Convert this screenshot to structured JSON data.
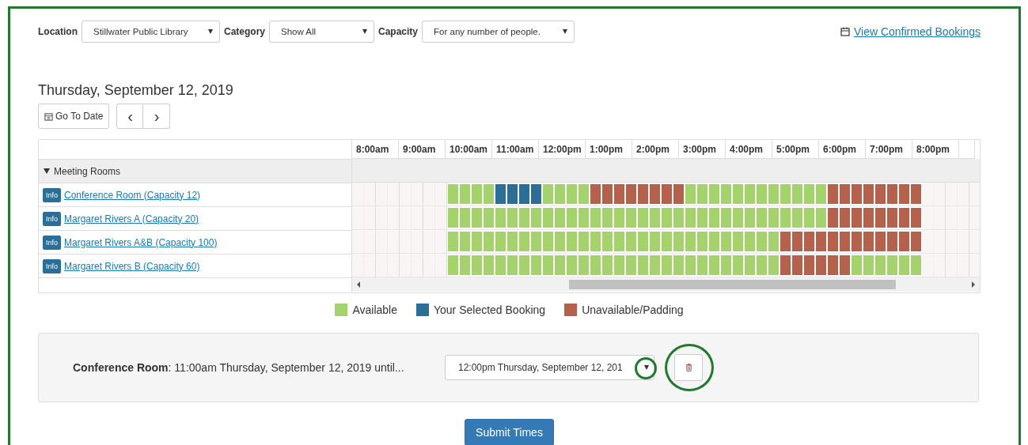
{
  "filters": [
    {
      "label": "Location",
      "value": "Stillwater Public Library"
    },
    {
      "label": "Category",
      "value": "Show All"
    },
    {
      "label": "Capacity",
      "value": "For any number of people."
    }
  ],
  "confirmed_link": "View Confirmed Bookings",
  "date_heading": "Thursday, September 12, 2019",
  "go_to_date": "Go To Date",
  "nav_prev": "‹",
  "nav_next": "›",
  "times": [
    "8:00am",
    "9:00am",
    "10:00am",
    "11:00am",
    "12:00pm",
    "1:00pm",
    "2:00pm",
    "3:00pm",
    "4:00pm",
    "5:00pm",
    "6:00pm",
    "7:00pm",
    "8:00pm"
  ],
  "group": {
    "label": "Meeting Rooms",
    "expanded": true
  },
  "rooms": [
    {
      "badge": "Info",
      "name": "Conference Room (Capacity 12)",
      "slots": [
        {
          "kind": "empty"
        },
        {
          "kind": "empty"
        },
        {
          "kind": "empty"
        },
        {
          "kind": "empty"
        },
        {
          "kind": "empty"
        },
        {
          "kind": "empty"
        },
        {
          "kind": "empty"
        },
        {
          "kind": "empty"
        },
        {
          "kind": "open"
        },
        {
          "kind": "open"
        },
        {
          "kind": "open"
        },
        {
          "kind": "open"
        },
        {
          "kind": "mine"
        },
        {
          "kind": "mine"
        },
        {
          "kind": "mine"
        },
        {
          "kind": "mine"
        },
        {
          "kind": "open"
        },
        {
          "kind": "open"
        },
        {
          "kind": "open"
        },
        {
          "kind": "open"
        },
        {
          "kind": "taken"
        },
        {
          "kind": "taken"
        },
        {
          "kind": "taken"
        },
        {
          "kind": "taken"
        },
        {
          "kind": "taken"
        },
        {
          "kind": "taken"
        },
        {
          "kind": "taken"
        },
        {
          "kind": "taken"
        },
        {
          "kind": "open"
        },
        {
          "kind": "open"
        },
        {
          "kind": "open"
        },
        {
          "kind": "open"
        },
        {
          "kind": "open"
        },
        {
          "kind": "open"
        },
        {
          "kind": "open"
        },
        {
          "kind": "open"
        },
        {
          "kind": "open"
        },
        {
          "kind": "open"
        },
        {
          "kind": "open"
        },
        {
          "kind": "open"
        },
        {
          "kind": "taken"
        },
        {
          "kind": "taken"
        },
        {
          "kind": "taken"
        },
        {
          "kind": "taken"
        },
        {
          "kind": "taken"
        },
        {
          "kind": "taken"
        },
        {
          "kind": "taken"
        },
        {
          "kind": "taken"
        },
        {
          "kind": "empty"
        },
        {
          "kind": "empty"
        },
        {
          "kind": "empty"
        },
        {
          "kind": "empty"
        }
      ]
    },
    {
      "badge": "Info",
      "name": "Margaret Rivers A (Capacity 20)",
      "slots": [
        {
          "kind": "empty"
        },
        {
          "kind": "empty"
        },
        {
          "kind": "empty"
        },
        {
          "kind": "empty"
        },
        {
          "kind": "empty"
        },
        {
          "kind": "empty"
        },
        {
          "kind": "empty"
        },
        {
          "kind": "empty"
        },
        {
          "kind": "open"
        },
        {
          "kind": "open"
        },
        {
          "kind": "open"
        },
        {
          "kind": "open"
        },
        {
          "kind": "open"
        },
        {
          "kind": "open"
        },
        {
          "kind": "open"
        },
        {
          "kind": "open"
        },
        {
          "kind": "open"
        },
        {
          "kind": "open"
        },
        {
          "kind": "open"
        },
        {
          "kind": "open"
        },
        {
          "kind": "open"
        },
        {
          "kind": "open"
        },
        {
          "kind": "open"
        },
        {
          "kind": "open"
        },
        {
          "kind": "open"
        },
        {
          "kind": "open"
        },
        {
          "kind": "open"
        },
        {
          "kind": "open"
        },
        {
          "kind": "open"
        },
        {
          "kind": "open"
        },
        {
          "kind": "open"
        },
        {
          "kind": "open"
        },
        {
          "kind": "open"
        },
        {
          "kind": "open"
        },
        {
          "kind": "open"
        },
        {
          "kind": "open"
        },
        {
          "kind": "open"
        },
        {
          "kind": "open"
        },
        {
          "kind": "open"
        },
        {
          "kind": "open"
        },
        {
          "kind": "taken"
        },
        {
          "kind": "taken"
        },
        {
          "kind": "taken"
        },
        {
          "kind": "taken"
        },
        {
          "kind": "taken"
        },
        {
          "kind": "taken"
        },
        {
          "kind": "taken"
        },
        {
          "kind": "taken"
        },
        {
          "kind": "empty"
        },
        {
          "kind": "empty"
        },
        {
          "kind": "empty"
        },
        {
          "kind": "empty"
        }
      ]
    },
    {
      "badge": "Info",
      "name": "Margaret Rivers A&B (Capacity 100)",
      "slots": [
        {
          "kind": "empty"
        },
        {
          "kind": "empty"
        },
        {
          "kind": "empty"
        },
        {
          "kind": "empty"
        },
        {
          "kind": "empty"
        },
        {
          "kind": "empty"
        },
        {
          "kind": "empty"
        },
        {
          "kind": "empty"
        },
        {
          "kind": "open"
        },
        {
          "kind": "open"
        },
        {
          "kind": "open"
        },
        {
          "kind": "open"
        },
        {
          "kind": "open"
        },
        {
          "kind": "open"
        },
        {
          "kind": "open"
        },
        {
          "kind": "open"
        },
        {
          "kind": "open"
        },
        {
          "kind": "open"
        },
        {
          "kind": "open"
        },
        {
          "kind": "open"
        },
        {
          "kind": "open"
        },
        {
          "kind": "open"
        },
        {
          "kind": "open"
        },
        {
          "kind": "open"
        },
        {
          "kind": "open"
        },
        {
          "kind": "open"
        },
        {
          "kind": "open"
        },
        {
          "kind": "open"
        },
        {
          "kind": "open"
        },
        {
          "kind": "open"
        },
        {
          "kind": "open"
        },
        {
          "kind": "open"
        },
        {
          "kind": "open"
        },
        {
          "kind": "open"
        },
        {
          "kind": "open"
        },
        {
          "kind": "open"
        },
        {
          "kind": "taken"
        },
        {
          "kind": "taken"
        },
        {
          "kind": "taken"
        },
        {
          "kind": "taken"
        },
        {
          "kind": "taken"
        },
        {
          "kind": "taken"
        },
        {
          "kind": "taken"
        },
        {
          "kind": "taken"
        },
        {
          "kind": "taken"
        },
        {
          "kind": "taken"
        },
        {
          "kind": "taken"
        },
        {
          "kind": "taken"
        },
        {
          "kind": "empty"
        },
        {
          "kind": "empty"
        },
        {
          "kind": "empty"
        },
        {
          "kind": "empty"
        }
      ]
    },
    {
      "badge": "Info",
      "name": "Margaret Rivers B (Capacity 60)",
      "slots": [
        {
          "kind": "empty"
        },
        {
          "kind": "empty"
        },
        {
          "kind": "empty"
        },
        {
          "kind": "empty"
        },
        {
          "kind": "empty"
        },
        {
          "kind": "empty"
        },
        {
          "kind": "empty"
        },
        {
          "kind": "empty"
        },
        {
          "kind": "open"
        },
        {
          "kind": "open"
        },
        {
          "kind": "open"
        },
        {
          "kind": "open"
        },
        {
          "kind": "open"
        },
        {
          "kind": "open"
        },
        {
          "kind": "open"
        },
        {
          "kind": "open"
        },
        {
          "kind": "open"
        },
        {
          "kind": "open"
        },
        {
          "kind": "open"
        },
        {
          "kind": "open"
        },
        {
          "kind": "open"
        },
        {
          "kind": "open"
        },
        {
          "kind": "open"
        },
        {
          "kind": "open"
        },
        {
          "kind": "open"
        },
        {
          "kind": "open"
        },
        {
          "kind": "open"
        },
        {
          "kind": "open"
        },
        {
          "kind": "open"
        },
        {
          "kind": "open"
        },
        {
          "kind": "open"
        },
        {
          "kind": "open"
        },
        {
          "kind": "open"
        },
        {
          "kind": "open"
        },
        {
          "kind": "open"
        },
        {
          "kind": "open"
        },
        {
          "kind": "taken"
        },
        {
          "kind": "taken"
        },
        {
          "kind": "taken"
        },
        {
          "kind": "taken"
        },
        {
          "kind": "taken"
        },
        {
          "kind": "taken"
        },
        {
          "kind": "open"
        },
        {
          "kind": "open"
        },
        {
          "kind": "open"
        },
        {
          "kind": "open"
        },
        {
          "kind": "open"
        },
        {
          "kind": "open"
        },
        {
          "kind": "empty"
        },
        {
          "kind": "empty"
        },
        {
          "kind": "empty"
        },
        {
          "kind": "empty"
        }
      ]
    }
  ],
  "legend": [
    {
      "kind": "open",
      "label": "Available",
      "color": "#a4d36c"
    },
    {
      "kind": "mine",
      "label": "Your Selected Booking",
      "color": "#2b6f99"
    },
    {
      "kind": "taken",
      "label": "Unavailable/Padding",
      "color": "#b5614b"
    }
  ],
  "booking": {
    "room": "Conference Room",
    "start": ": 11:00am Thursday, September 12, 2019 until...",
    "end": "12:00pm Thursday, September 12, 201"
  },
  "submit": "Submit Times"
}
